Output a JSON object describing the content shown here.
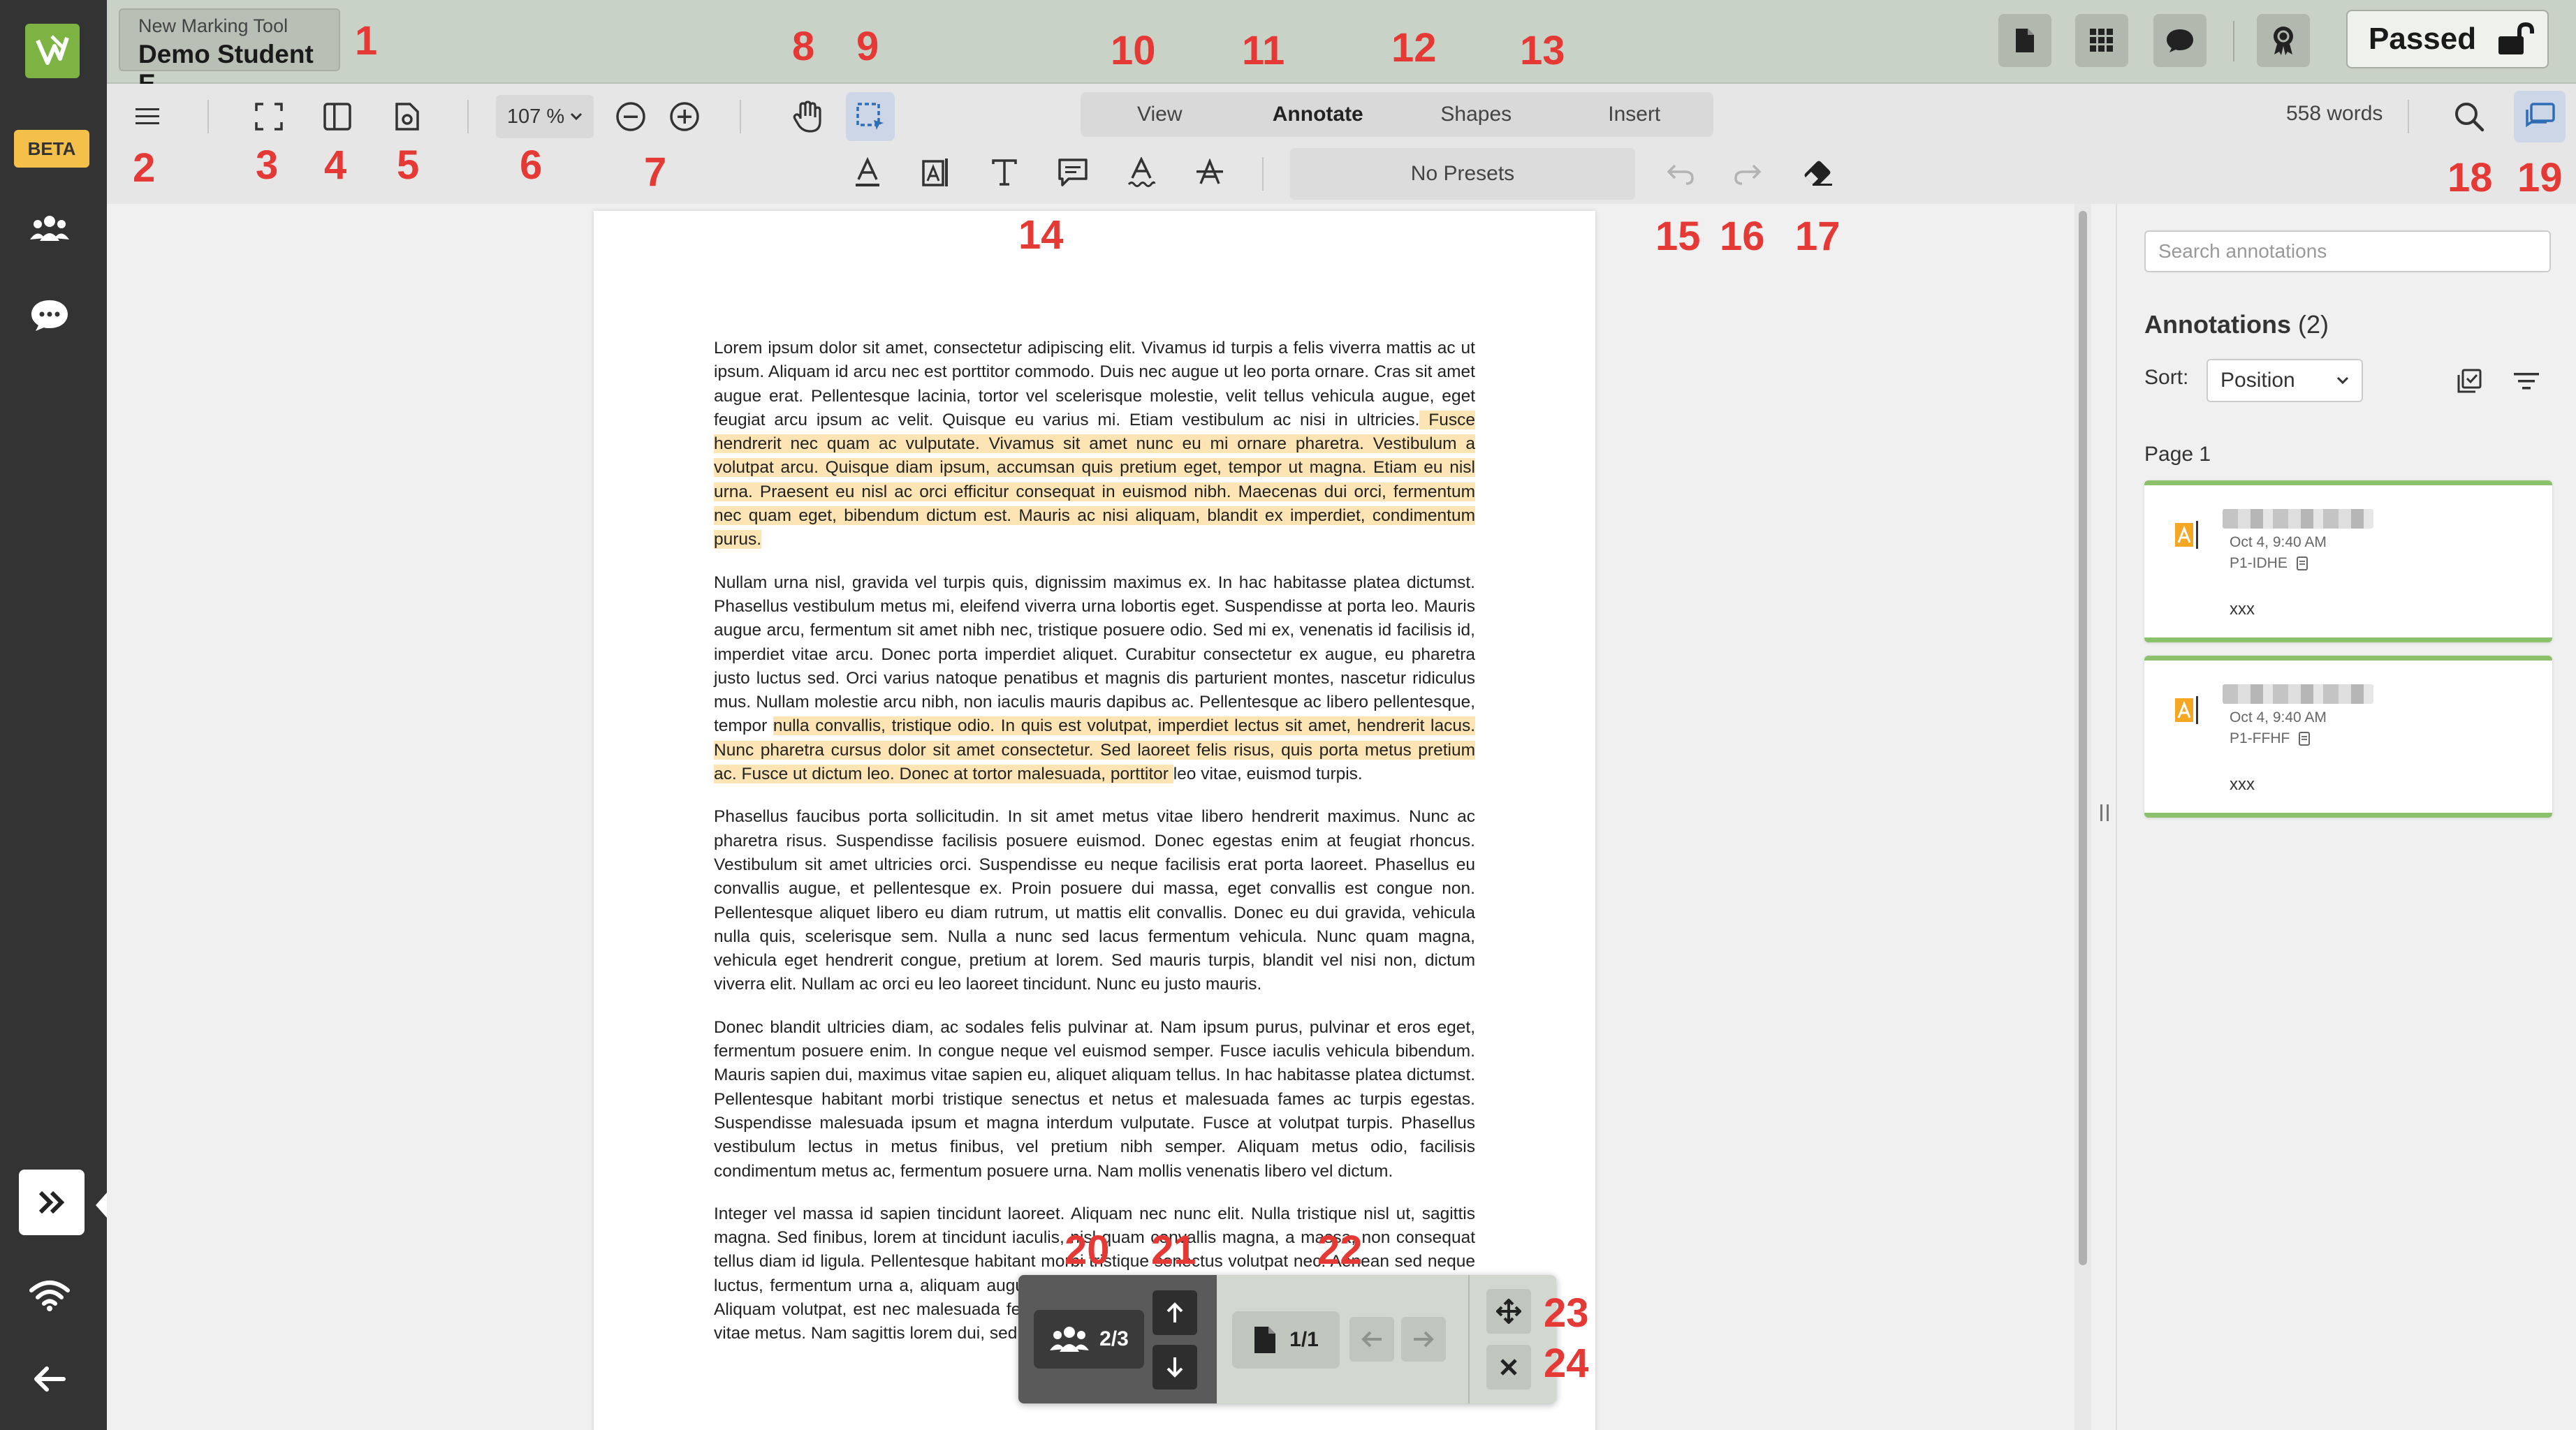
{
  "header": {
    "tool_name": "New Marking Tool",
    "student_name": "Demo Student E",
    "status": "Passed"
  },
  "sidebar": {
    "beta_label": "BETA"
  },
  "toolbar": {
    "zoom": "107 %",
    "tabs": [
      "View",
      "Annotate",
      "Shapes",
      "Insert"
    ],
    "active_tab": "Annotate",
    "word_count": "558 words",
    "presets": "No Presets"
  },
  "document": {
    "paragraphs": [
      {
        "before": "Lorem ipsum dolor sit amet, consectetur adipiscing elit. Vivamus id turpis a felis viverra mattis ac ut ipsum. Aliquam id arcu nec est porttitor commodo. Duis nec augue ut leo porta ornare. Cras sit amet augue erat. Pellentesque lacinia, tortor vel scelerisque molestie, velit tellus vehicula augue, eget feugiat arcu ipsum ac velit. Quisque eu varius mi. Etiam vestibulum ac nisi in ultricies.",
        "highlight": " Fusce hendrerit nec quam ac vulputate. Vivamus sit amet nunc eu mi ornare pharetra. Vestibulum a volutpat arcu. Quisque diam ipsum, accumsan quis pretium eget, tempor ut magna. Etiam eu nisl urna. Praesent eu nisl ac orci efficitur consequat in euismod nibh. Maecenas dui orci, fermentum nec quam eget, bibendum dictum est. Mauris ac nisi aliquam, blandit ex imperdiet, condimentum purus.",
        "after": ""
      },
      {
        "before": "Nullam urna nisl, gravida vel turpis quis, dignissim maximus ex. In hac habitasse platea dictumst. Phasellus vestibulum metus mi, eleifend viverra urna lobortis eget. Suspendisse at porta leo. Mauris augue arcu, fermentum sit amet nibh nec, tristique posuere odio. Sed mi ex, venenatis id facilisis id, imperdiet vitae arcu. Donec porta imperdiet aliquet. Curabitur consectetur ex augue, eu pharetra justo luctus sed. Orci varius natoque penatibus et magnis dis parturient montes, nascetur ridiculus mus. Nullam molestie arcu nibh, non iaculis mauris dapibus ac. Pellentesque ac libero pellentesque, tempor ",
        "highlight": "nulla convallis, tristique odio. In quis est volutpat, imperdiet lectus sit amet, hendrerit lacus. Nunc pharetra cursus dolor sit amet consectetur. Sed laoreet felis risus, quis porta metus pretium ac. Fusce ut dictum leo. Donec at tortor malesuada, porttitor ",
        "after": "leo vitae, euismod turpis."
      },
      {
        "before": "Phasellus faucibus porta sollicitudin. In sit amet metus vitae libero hendrerit maximus. Nunc ac pharetra risus. Suspendisse facilisis posuere euismod. Donec egestas enim at feugiat rhoncus. Vestibulum sit amet ultricies orci. Suspendisse eu neque facilisis erat porta laoreet. Phasellus eu convallis augue, et pellentesque ex. Proin posuere dui massa, eget convallis est congue non. Pellentesque aliquet libero eu diam rutrum, ut mattis elit convallis. Donec eu dui gravida, vehicula nulla quis, scelerisque sem. Nulla a nunc sed lacus fermentum vehicula. Nunc quam magna, vehicula eget hendrerit congue, pretium at lorem. Sed mauris turpis, blandit vel nisi non, dictum viverra elit. Nullam ac orci eu leo laoreet tincidunt. Nunc eu justo mauris.",
        "highlight": "",
        "after": ""
      },
      {
        "before": "Donec blandit ultricies diam, ac sodales felis pulvinar at. Nam ipsum purus, pulvinar et eros eget, fermentum posuere enim. In congue neque vel euismod semper. Fusce iaculis vehicula bibendum. Mauris sapien dui, maximus vitae sapien eu, aliquet aliquam tellus. In hac habitasse platea dictumst. Pellentesque habitant morbi tristique senectus et netus et malesuada fames ac turpis egestas. Suspendisse malesuada ipsum et magna interdum vulputate. Fusce at volutpat turpis. Phasellus vestibulum lectus in metus finibus, vel pretium nibh semper. Aliquam metus odio, facilisis condimentum metus ac, fermentum posuere urna. Nam mollis venenatis libero vel dictum.",
        "highlight": "",
        "after": ""
      },
      {
        "before": "Integer vel massa id sapien tincidunt laoreet. Aliquam nec nunc elit. Nulla tristique nisl ut, sagittis magna. Sed finibus, lorem at tincidunt iaculis, nisl quam convallis magna, a massa, non consequat tellus diam id ligula. Pellentesque habitant morbi tristique senectus volutpat nec. Aenean sed neque luctus, fermentum urna a, aliquam augue. Lorem ipsum dolor sit amet, consectetur adipiscing elit. Aliquam volutpat, est nec malesuada feugiat, lacus neque eleifend erat, sed consectetur velit ante vitae metus. Nam sagittis lorem dui, sed egestas dolor convallis sed. Proin vehicula libero",
        "highlight": "",
        "after": ""
      }
    ]
  },
  "annotations_panel": {
    "search_placeholder": "Search annotations",
    "title": "Annotations",
    "count": "(2)",
    "sort_label": "Sort:",
    "sort_value": "Position",
    "page_label": "Page 1",
    "items": [
      {
        "date": "Oct 4, 9:40 AM",
        "id": "P1-IDHE",
        "text": "xxx"
      },
      {
        "date": "Oct 4, 9:40 AM",
        "id": "P1-FFHF",
        "text": "xxx"
      }
    ]
  },
  "float_bar": {
    "students": "2/3",
    "pages": "1/1"
  },
  "callouts": [
    "1",
    "2",
    "3",
    "4",
    "5",
    "6",
    "7",
    "8",
    "9",
    "10",
    "11",
    "12",
    "13",
    "14",
    "15",
    "16",
    "17",
    "18",
    "19",
    "20",
    "21",
    "22",
    "23",
    "24"
  ],
  "colors": {
    "accent_green": "#7cb342",
    "header_bg": "#c9d2c6",
    "highlight": "#fde4b4",
    "beta": "#f5c04a",
    "callout_red": "#e53935"
  }
}
